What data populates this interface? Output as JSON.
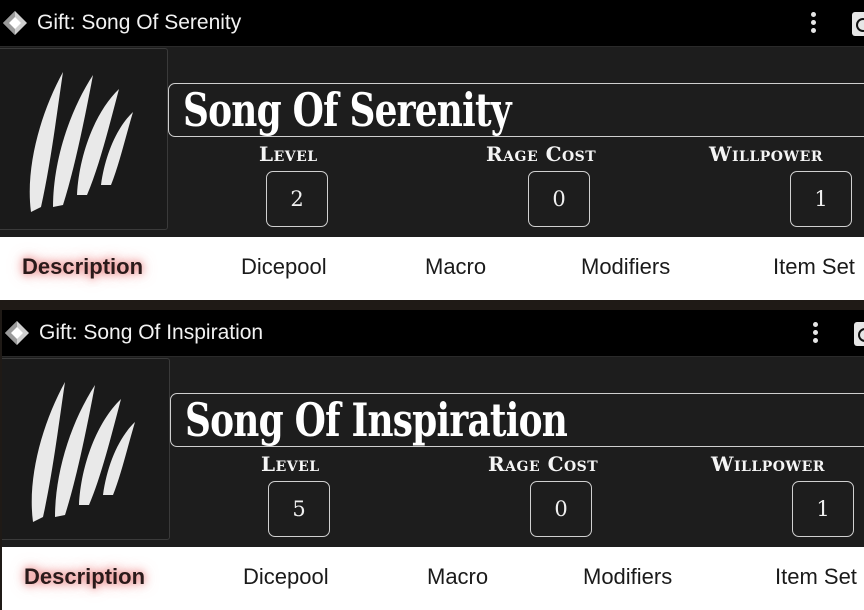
{
  "sheets": [
    {
      "window_title": "Gift: Song Of Serenity",
      "name": "Song Of Serenity",
      "stats": {
        "level_label": "Level",
        "level_value": "2",
        "rage_label": "Rage Cost",
        "rage_value": "0",
        "willpower_label": "Willpower",
        "willpower_value": "1"
      },
      "tabs": [
        "Description",
        "Dicepool",
        "Macro",
        "Modifiers",
        "Item Set"
      ],
      "active_tab": "Description"
    },
    {
      "window_title": "Gift: Song Of Inspiration",
      "name": "Song Of Inspiration",
      "stats": {
        "level_label": "Level",
        "level_value": "5",
        "rage_label": "Rage Cost",
        "rage_value": "0",
        "willpower_label": "Willpower",
        "willpower_value": "1"
      },
      "tabs": [
        "Description",
        "Dicepool",
        "Macro",
        "Modifiers",
        "Item Set"
      ],
      "active_tab": "Description"
    }
  ],
  "icons": {
    "app": "d20-logo-icon",
    "menu": "kebab-menu-icon",
    "portrait": "claw-marks-icon"
  },
  "colors": {
    "titlebar_bg": "#000000",
    "sheet_bg": "#1d1d1d",
    "tab_bar_bg": "#ffffff",
    "active_tab_glow": "#e65a5a"
  }
}
